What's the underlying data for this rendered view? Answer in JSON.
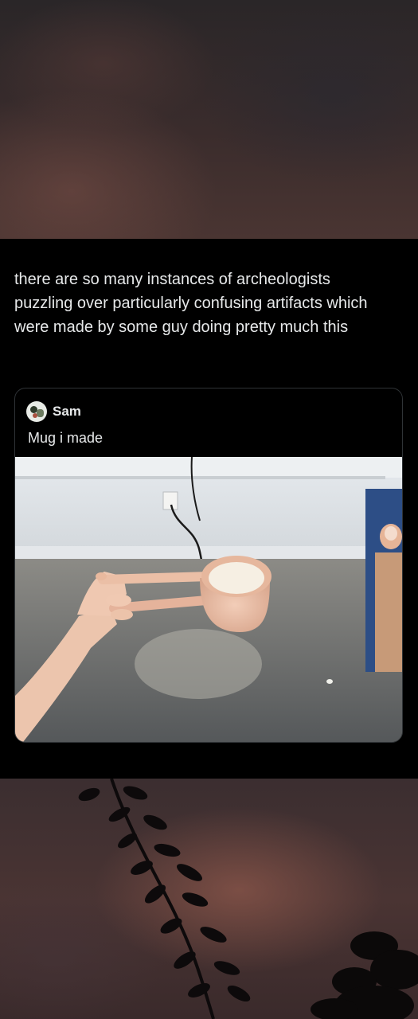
{
  "post": {
    "text": "there are so many instances of archeologists puzzling over particularly confusing artifacts which were made by some guy doing pretty much this"
  },
  "quoted_post": {
    "author": "Sam",
    "text": "Mug i made",
    "avatar_icon": "profile-photo-icon"
  },
  "colors": {
    "text": "#e7e9ea",
    "card_border": "#2f3336",
    "background": "#000000"
  }
}
